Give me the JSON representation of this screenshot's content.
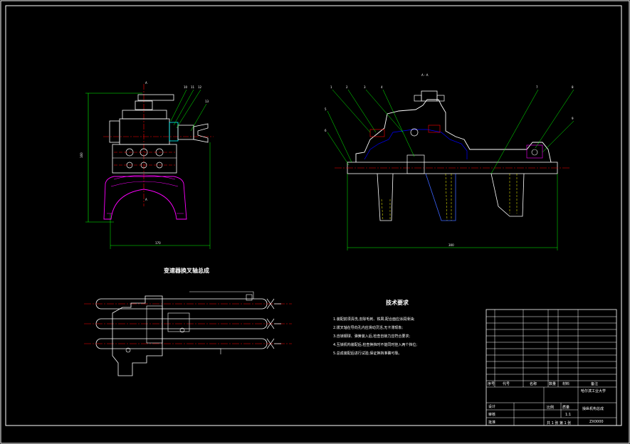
{
  "drawing": {
    "title_main": "变速器换叉轴总成",
    "section_label": "A - A",
    "tech_title": "技术要求",
    "tech_notes": [
      "1.装配前须清洗,去除毛刺、铁屑,配合面应涂润滑油;",
      "2.拨叉轴在导向孔内应滑动灵活,无卡滞现象;",
      "3.自锁钢球、弹簧装入后,检查自锁力应符合要求;",
      "4.互锁机构装配后,检查换挡时不能同时挂入两个挡位;",
      "5.总成装配后进行试验,保证换挡准确可靠。"
    ],
    "dimensions": {
      "left_width": "170",
      "left_height": "160",
      "right_width": "300"
    },
    "balloons_left": [
      "10",
      "11",
      "12",
      "13"
    ],
    "balloons_right": [
      "1",
      "2",
      "3",
      "4",
      "5",
      "6",
      "7",
      "8",
      "9"
    ],
    "section_arrow_letter": "A"
  },
  "title_block": {
    "school": "哈尔滨工业大学",
    "drawing_name": "操纵机构总成",
    "scale_label": "比例",
    "scale": "1:1",
    "sheet_label": "共 1 张 第 1 张",
    "drawing_no": "ZX0000",
    "designer_label": "设计",
    "checker_label": "审核",
    "approve_label": "批准",
    "mass_label": "质量",
    "header": [
      "序号",
      "代号",
      "名称",
      "数量",
      "材料",
      "备注"
    ]
  },
  "colors": {
    "background": "#000000",
    "line": "#ffffff",
    "center": "#ff0000",
    "hatch": "#ff00ff",
    "leader": "#00ff00",
    "hidden": "#ffff00",
    "part_cyan": "#00ffff",
    "part_blue": "#3c64ff"
  }
}
